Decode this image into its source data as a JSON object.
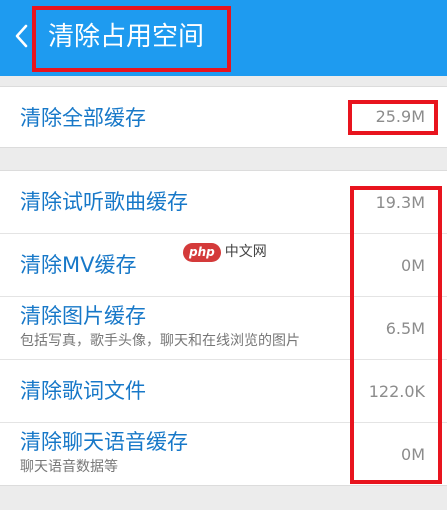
{
  "header": {
    "title": "清除占用空间",
    "back_icon": "chevron-left-icon",
    "background_color": "#1e9bf0"
  },
  "clear_all": {
    "label": "清除全部缓存",
    "value": "25.9M"
  },
  "items": [
    {
      "label": "清除试听歌曲缓存",
      "subtitle": "",
      "value": "19.3M"
    },
    {
      "label": "清除MV缓存",
      "subtitle": "",
      "value": "0M"
    },
    {
      "label": "清除图片缓存",
      "subtitle": "包括写真，歌手头像，聊天和在线浏览的图片",
      "value": "6.5M"
    },
    {
      "label": "清除歌词文件",
      "subtitle": "",
      "value": "122.0K"
    },
    {
      "label": "清除聊天语音缓存",
      "subtitle": "聊天语音数据等",
      "value": "0M"
    }
  ],
  "watermark": {
    "badge": "php",
    "text": "中文网"
  },
  "colors": {
    "accent": "#1778c8",
    "annotation": "#e8141e"
  }
}
